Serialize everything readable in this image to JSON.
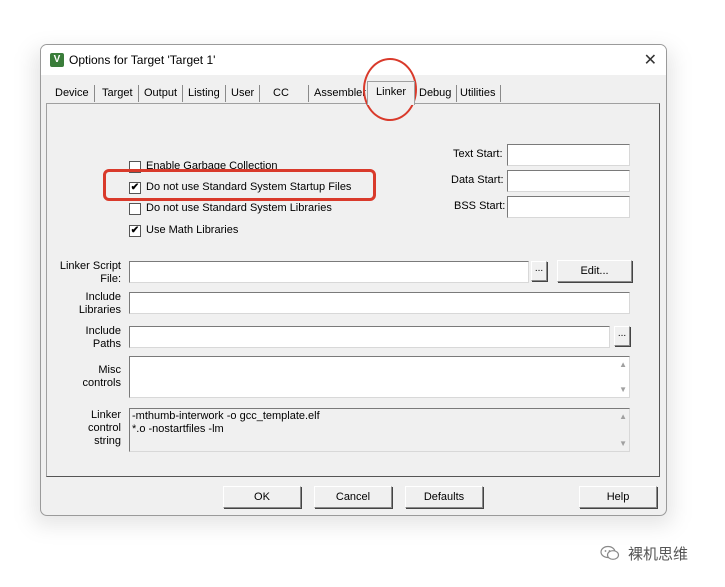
{
  "window": {
    "title": "Options for Target 'Target 1'",
    "close_glyph": "✕",
    "icon": "keil-app-icon"
  },
  "tabs": [
    "Device",
    "Target",
    "Output",
    "Listing",
    "User",
    "CC",
    "Assembler",
    "Linker",
    "Debug",
    "Utilities"
  ],
  "active_tab": "Linker",
  "options": {
    "gc": {
      "label": "Enable Garbage Collection",
      "checked": false
    },
    "no_startup": {
      "label": "Do not use Standard System Startup Files",
      "checked": true
    },
    "no_stdlib": {
      "label": "Do not use Standard System Libraries",
      "checked": false
    },
    "math": {
      "label": "Use Math Libraries",
      "checked": true
    },
    "check_glyph": "✔"
  },
  "addresses": {
    "text_start": {
      "label": "Text Start:",
      "value": ""
    },
    "data_start": {
      "label": "Data Start:",
      "value": ""
    },
    "bss_start": {
      "label": "BSS Start:",
      "value": ""
    }
  },
  "linker_script": {
    "label_line1": "Linker Script",
    "label_line2": "File:",
    "value": "",
    "browse": "...",
    "edit": "Edit..."
  },
  "include_libraries": {
    "label_line1": "Include",
    "label_line2": "Libraries",
    "value": ""
  },
  "include_paths": {
    "label_line1": "Include",
    "label_line2": "Paths",
    "value": "",
    "browse": "..."
  },
  "misc_controls": {
    "label_line1": "Misc",
    "label_line2": "controls",
    "value": ""
  },
  "linker_control": {
    "label_line1": "Linker",
    "label_line2": "control",
    "label_line3": "string",
    "value": "-mthumb-interwork -o gcc_template.elf\n*.o -nostartfiles -lm"
  },
  "buttons": {
    "ok": "OK",
    "cancel": "Cancel",
    "defaults": "Defaults",
    "help": "Help"
  },
  "annotation_color": "#d93a2b",
  "watermark": {
    "text": "裸机思维",
    "icon": "wechat-icon"
  }
}
